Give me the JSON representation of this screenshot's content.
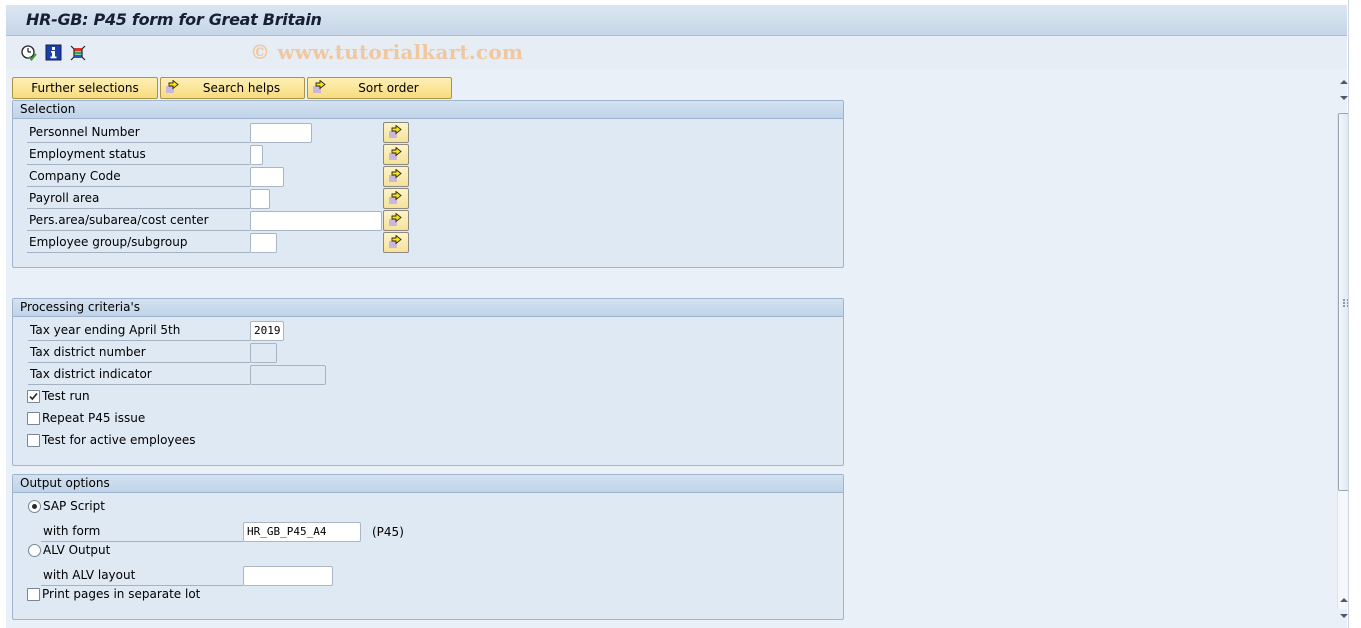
{
  "window": {
    "title": "HR-GB: P45 form for Great Britain",
    "watermark": "© www.tutorialkart.com"
  },
  "toolbar": {
    "icons": [
      {
        "name": "execute-clock-icon",
        "tooltip": "Execute"
      },
      {
        "name": "info-icon",
        "tooltip": "Program documentation"
      },
      {
        "name": "selection-options-icon",
        "tooltip": "Selection options"
      }
    ]
  },
  "buttons": {
    "further_selections": "Further selections",
    "search_helps": "Search helps",
    "sort_order": "Sort order"
  },
  "selection": {
    "title": "Selection",
    "fields": [
      {
        "label": "Personnel Number",
        "value": ""
      },
      {
        "label": "Employment status",
        "value": ""
      },
      {
        "label": "Company Code",
        "value": ""
      },
      {
        "label": "Payroll area",
        "value": ""
      },
      {
        "label": "Pers.area/subarea/cost center",
        "value": ""
      },
      {
        "label": "Employee group/subgroup",
        "value": ""
      }
    ]
  },
  "processing": {
    "title": "Processing criteria's",
    "fields": [
      {
        "label": "Tax year ending April 5th",
        "value": "2019"
      },
      {
        "label": "Tax district number",
        "value": ""
      },
      {
        "label": "Tax district indicator",
        "value": ""
      }
    ],
    "checkboxes": [
      {
        "label": "Test run",
        "checked": true
      },
      {
        "label": "Repeat P45 issue",
        "checked": false
      },
      {
        "label": "Test for active employees",
        "checked": false
      }
    ]
  },
  "output": {
    "title": "Output options",
    "sapscript_label": "SAP Script",
    "sapscript_selected": true,
    "with_form_label": "with form",
    "with_form_value": "HR_GB_P45_A4",
    "with_form_suffix": "(P45)",
    "alv_label": "ALV Output",
    "alv_selected": false,
    "alv_layout_label": "with ALV layout",
    "alv_layout_value": "",
    "print_separate_label": "Print pages in separate lot",
    "print_separate_checked": false
  },
  "colors": {
    "button_yellow": "#f7dc7e",
    "group_bg": "#dfe9f4",
    "title_text": "#152033"
  }
}
